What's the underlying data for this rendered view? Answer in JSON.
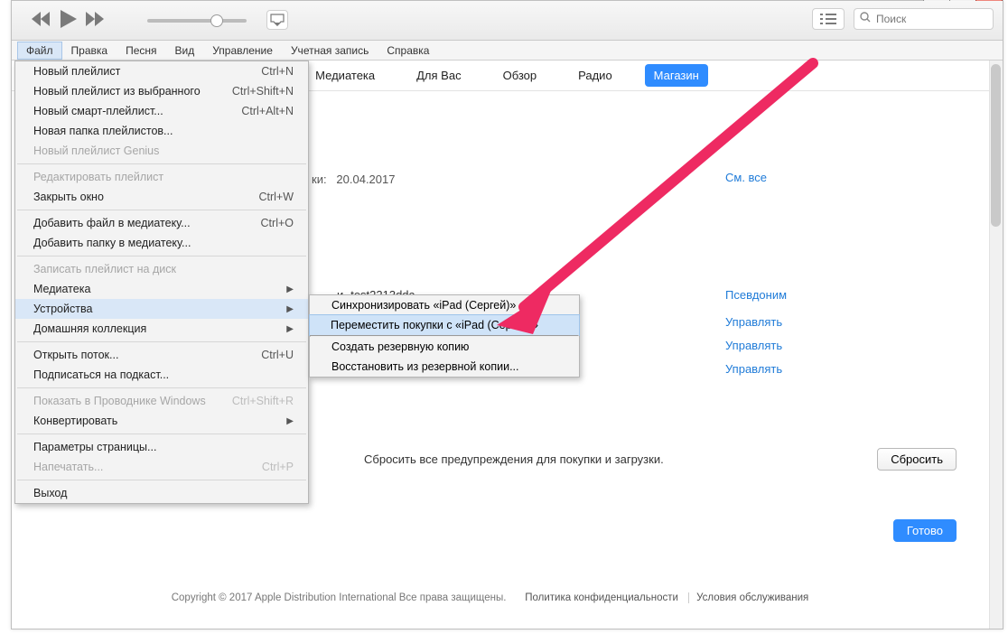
{
  "search_placeholder": "Поиск",
  "menubar": [
    "Файл",
    "Правка",
    "Песня",
    "Вид",
    "Управление",
    "Учетная запись",
    "Справка"
  ],
  "navtabs": {
    "items": [
      "Медиатека",
      "Для Вас",
      "Обзор",
      "Радио",
      "Магазин"
    ],
    "selected": "Магазин"
  },
  "body": {
    "date_label": "ки:",
    "date_value": "20.04.2017",
    "see_all": "См. все",
    "mid_text_prefix": "и·   ",
    "mid_text": "test2213ddc",
    "links": {
      "l1": "Псевдоним",
      "l2": "Управлять",
      "l3": "Управлять",
      "l4": "Управлять"
    },
    "reset_text": "Сбросить все предупреждения для покупки и загрузки.",
    "reset_btn": "Сбросить",
    "done_btn": "Готово"
  },
  "footer": {
    "copyright": "Copyright © 2017 Apple Distribution International Все права защищены.",
    "privacy": "Политика конфиденциальности",
    "terms": "Условия обслуживания"
  },
  "file_menu": [
    {
      "t": "item",
      "label": "Новый плейлист",
      "sc": "Ctrl+N"
    },
    {
      "t": "item",
      "label": "Новый плейлист из выбранного",
      "sc": "Ctrl+Shift+N"
    },
    {
      "t": "item",
      "label": "Новый смарт-плейлист...",
      "sc": "Ctrl+Alt+N"
    },
    {
      "t": "item",
      "label": "Новая папка плейлистов..."
    },
    {
      "t": "item",
      "label": "Новый плейлист Genius",
      "disabled": true
    },
    {
      "t": "sep"
    },
    {
      "t": "item",
      "label": "Редактировать плейлист",
      "disabled": true
    },
    {
      "t": "item",
      "label": "Закрыть окно",
      "sc": "Ctrl+W"
    },
    {
      "t": "sep"
    },
    {
      "t": "item",
      "label": "Добавить файл в медиатеку...",
      "sc": "Ctrl+O"
    },
    {
      "t": "item",
      "label": "Добавить папку в медиатеку..."
    },
    {
      "t": "sep"
    },
    {
      "t": "item",
      "label": "Записать плейлист на диск",
      "disabled": true
    },
    {
      "t": "sub",
      "label": "Медиатека"
    },
    {
      "t": "sub",
      "label": "Устройства",
      "hl": true
    },
    {
      "t": "sub",
      "label": "Домашняя коллекция"
    },
    {
      "t": "sep"
    },
    {
      "t": "item",
      "label": "Открыть поток...",
      "sc": "Ctrl+U"
    },
    {
      "t": "item",
      "label": "Подписаться на подкаст..."
    },
    {
      "t": "sep"
    },
    {
      "t": "item",
      "label": "Показать в Проводнике Windows",
      "sc": "Ctrl+Shift+R",
      "disabled": true
    },
    {
      "t": "sub",
      "label": "Конвертировать"
    },
    {
      "t": "sep"
    },
    {
      "t": "item",
      "label": "Параметры страницы..."
    },
    {
      "t": "item",
      "label": "Напечатать...",
      "sc": "Ctrl+P",
      "disabled": true
    },
    {
      "t": "sep"
    },
    {
      "t": "item",
      "label": "Выход"
    }
  ],
  "devices_submenu": [
    {
      "label": "Синхронизировать «iPad (Сергей)»"
    },
    {
      "label": "Переместить покупки с «iPad (Сергей)»",
      "sel": true
    },
    {
      "t": "sep"
    },
    {
      "label": "Создать резервную копию"
    },
    {
      "label": "Восстановить из резервной копии..."
    }
  ]
}
